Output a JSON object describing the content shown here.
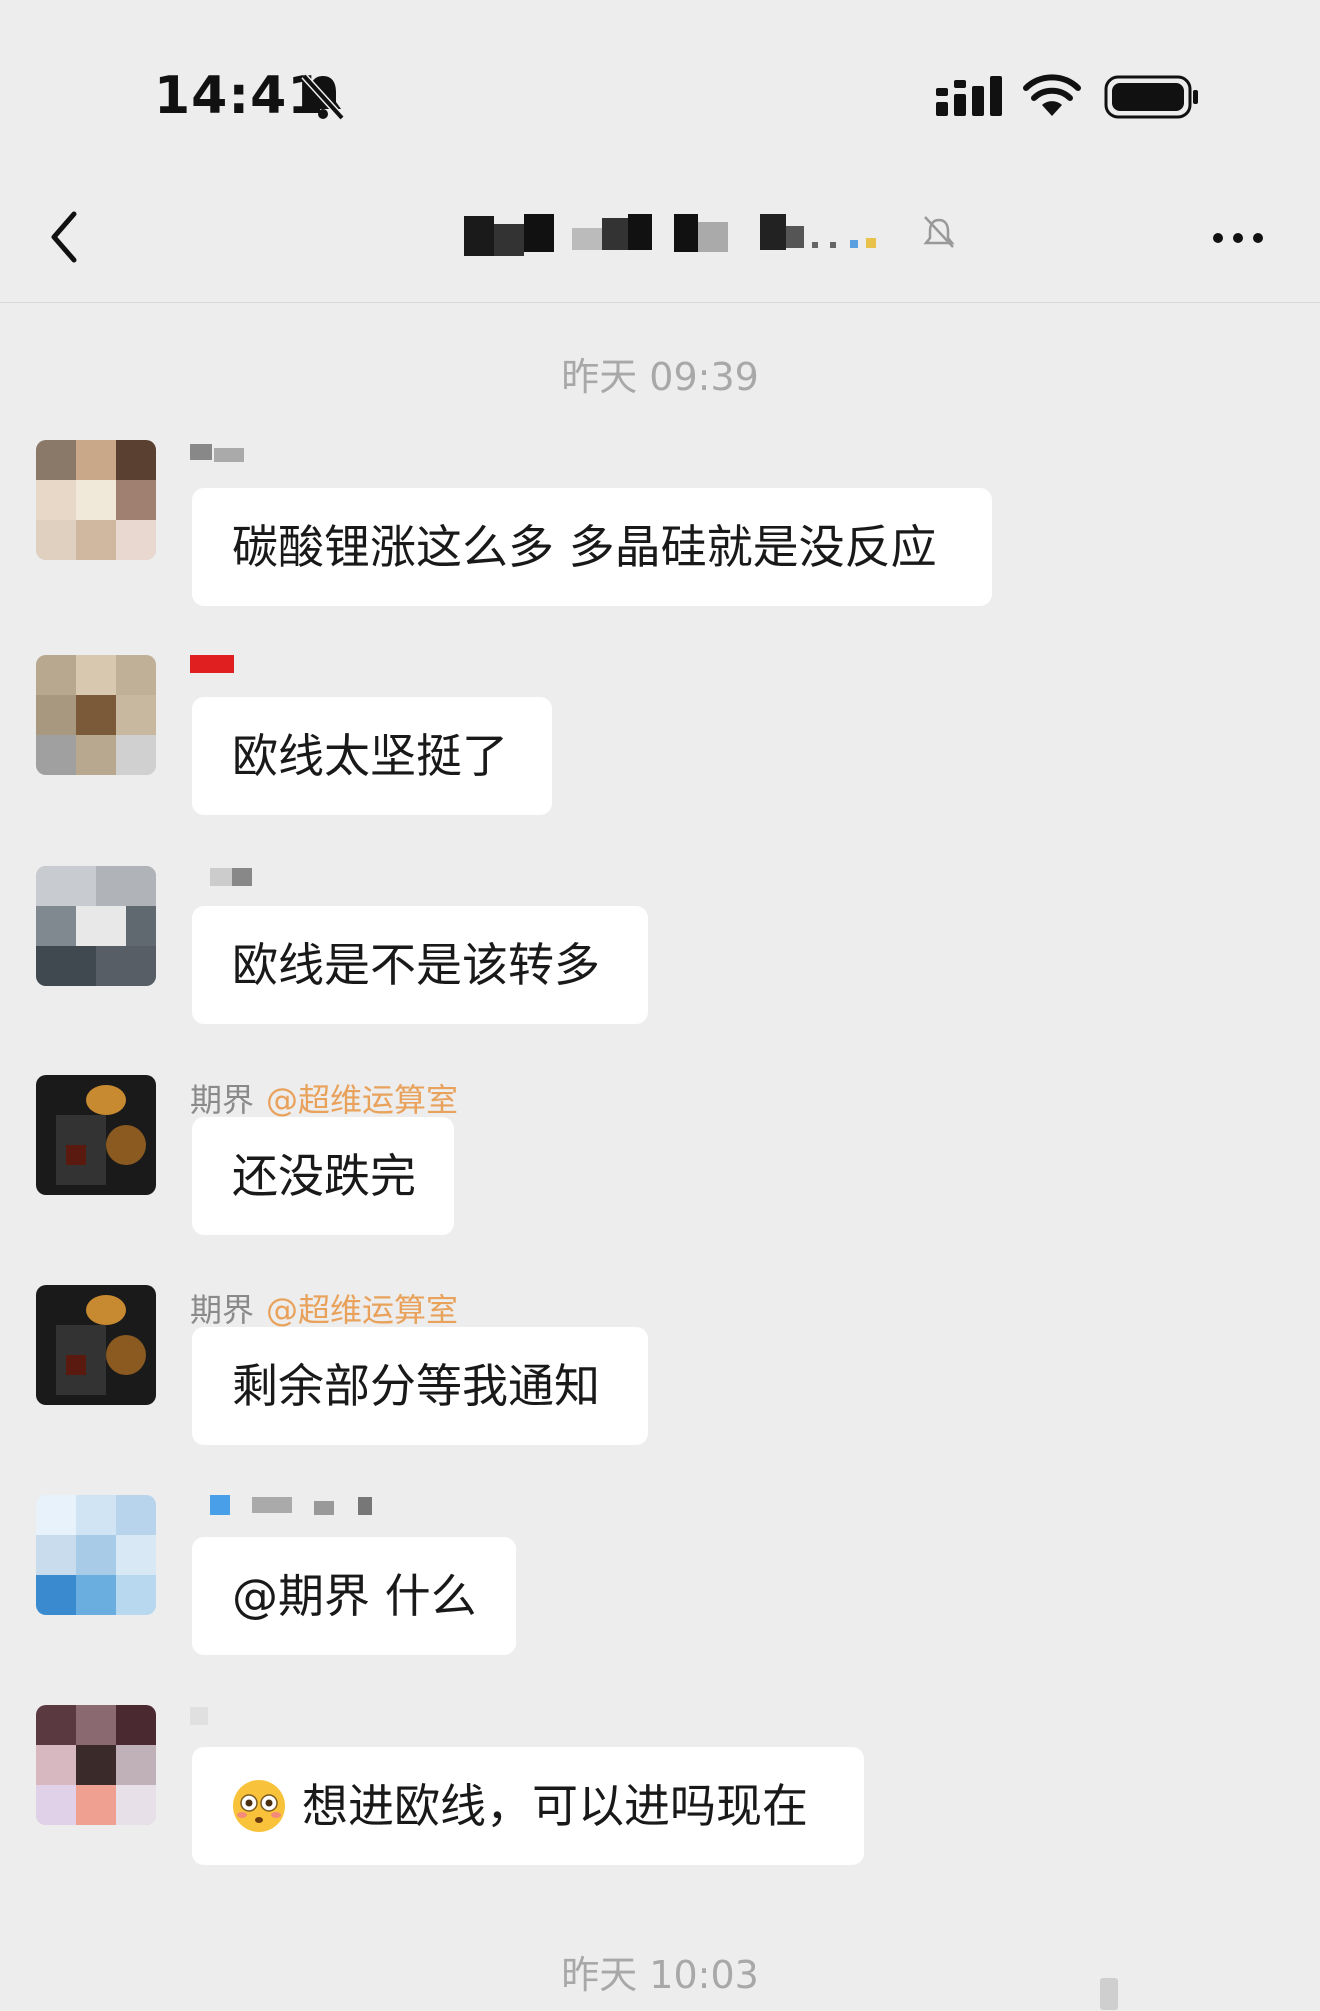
{
  "status_bar": {
    "time": "14:41",
    "icons": [
      "bell-slash-icon",
      "signal-icon",
      "wifi-icon",
      "battery-icon"
    ]
  },
  "nav": {
    "back_icon": "chevron-left-icon",
    "title_state": "redacted",
    "mute_icon": "muted-icon",
    "more_icon": "ellipsis-icon"
  },
  "chat": {
    "timestamp_1": "昨天 09:39",
    "timestamp_2": "昨天 10:03",
    "messages": [
      {
        "sender": "",
        "mention": "",
        "text": "碳酸锂涨这么多 多晶硅就是没反应"
      },
      {
        "sender": "",
        "mention": "",
        "text": "欧线太坚挺了"
      },
      {
        "sender": "",
        "mention": "",
        "text": "欧线是不是该转多"
      },
      {
        "sender": "期界",
        "mention": "@超维运算室",
        "text": "还没跌完"
      },
      {
        "sender": "期界",
        "mention": "@超维运算室",
        "text": "剩余部分等我通知"
      },
      {
        "sender": "",
        "mention": "",
        "text": "@期界 什么"
      },
      {
        "sender": "",
        "mention": "",
        "emoji": "flushed-face-emoji",
        "text": "想进欧线，可以进吗现在"
      }
    ]
  },
  "colors": {
    "background": "#ededed",
    "bubble": "#ffffff",
    "mention": "#e8a25c",
    "timestamp": "#a8a8a8"
  }
}
